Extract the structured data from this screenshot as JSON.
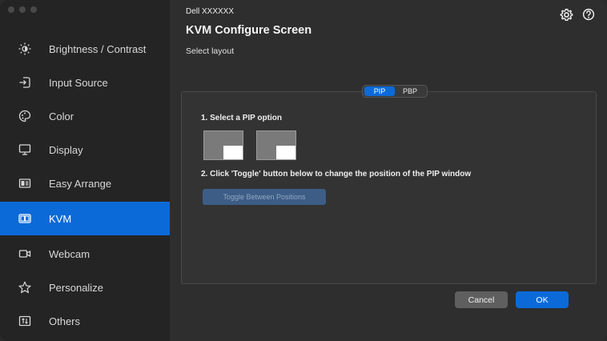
{
  "window": {
    "traffic_lights": [
      "#ff5f57",
      "#ffbd2e",
      "#28c840"
    ]
  },
  "header": {
    "device_name": "Dell XXXXXX",
    "title": "KVM Configure Screen",
    "subtitle": "Select layout",
    "icons": [
      "gear-icon",
      "help-icon"
    ]
  },
  "sidebar": {
    "accent": "#0b6ad8",
    "active_index": 5,
    "items": [
      {
        "label": "Brightness / Contrast",
        "icon": "brightness-icon"
      },
      {
        "label": "Input Source",
        "icon": "input-source-icon"
      },
      {
        "label": "Color",
        "icon": "color-palette-icon"
      },
      {
        "label": "Display",
        "icon": "monitor-icon"
      },
      {
        "label": "Easy Arrange",
        "icon": "easy-arrange-icon"
      },
      {
        "label": "KVM",
        "icon": "kvm-icon"
      },
      {
        "label": "Webcam",
        "icon": "webcam-icon"
      },
      {
        "label": "Personalize",
        "icon": "star-icon"
      },
      {
        "label": "Others",
        "icon": "others-icon"
      }
    ]
  },
  "layout_selector": {
    "options": [
      "PIP",
      "PBP"
    ],
    "selected": "PIP"
  },
  "pip": {
    "step1": "1. Select a PIP option",
    "options": [
      "pip-bottom-right",
      "pip-top-right"
    ],
    "step2": "2. Click 'Toggle' button below to change the position of the PIP window",
    "toggle_label": "Toggle Between Positions"
  },
  "footer": {
    "cancel_label": "Cancel",
    "ok_label": "OK"
  }
}
